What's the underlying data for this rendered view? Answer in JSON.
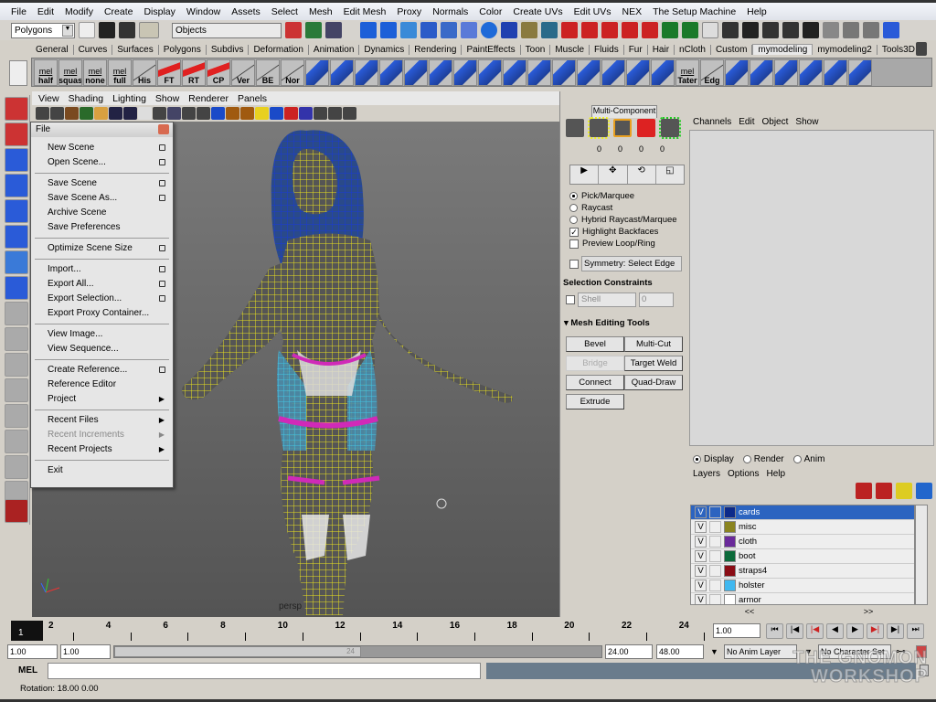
{
  "menubar": [
    "File",
    "Edit",
    "Modify",
    "Create",
    "Display",
    "Window",
    "Assets",
    "Select",
    "Mesh",
    "Edit Mesh",
    "Proxy",
    "Normals",
    "Color",
    "Create UVs",
    "Edit UVs",
    "NEX",
    "The Setup Machine",
    "Help"
  ],
  "status": {
    "mode": "Polygons",
    "selection_mask": "Objects"
  },
  "shelf_tabs": [
    "General",
    "Curves",
    "Surfaces",
    "Polygons",
    "Subdivs",
    "Deformation",
    "Animation",
    "Dynamics",
    "Rendering",
    "PaintEffects",
    "Toon",
    "Muscle",
    "Fluids",
    "Fur",
    "Hair",
    "nCloth",
    "Custom",
    "mymodeling",
    "mymodeling2",
    "Tools3D"
  ],
  "shelf_active": "mymodeling",
  "shelf_labels": [
    "half",
    "squas",
    "none",
    "full",
    "His",
    "FT",
    "RT",
    "CP",
    "Ver",
    "BE",
    "Nor",
    "",
    "",
    "",
    "",
    "",
    "",
    "",
    "",
    "",
    "",
    "",
    "",
    "",
    "",
    "",
    "Tater",
    "Edg",
    "",
    "",
    "",
    "",
    "",
    ""
  ],
  "viewport": {
    "menu": [
      "View",
      "Shading",
      "Lighting",
      "Show",
      "Renderer",
      "Panels"
    ],
    "camera": "persp"
  },
  "file_menu": {
    "title": "File",
    "groups": [
      [
        {
          "label": "New Scene",
          "opt": true
        },
        {
          "label": "Open Scene...",
          "opt": true
        }
      ],
      [
        {
          "label": "Save Scene",
          "opt": true
        },
        {
          "label": "Save Scene As...",
          "opt": true
        },
        {
          "label": "Archive Scene"
        },
        {
          "label": "Save Preferences"
        }
      ],
      [
        {
          "label": "Optimize Scene Size",
          "opt": true
        }
      ],
      [
        {
          "label": "Import...",
          "opt": true
        },
        {
          "label": "Export All...",
          "opt": true
        },
        {
          "label": "Export Selection...",
          "opt": true
        },
        {
          "label": "Export Proxy Container..."
        }
      ],
      [
        {
          "label": "View Image..."
        },
        {
          "label": "View Sequence..."
        }
      ],
      [
        {
          "label": "Create Reference...",
          "opt": true
        },
        {
          "label": "Reference Editor"
        },
        {
          "label": "Project",
          "sub": true
        }
      ],
      [
        {
          "label": "Recent Files",
          "sub": true
        },
        {
          "label": "Recent Increments",
          "sub": true,
          "disabled": true
        },
        {
          "label": "Recent Projects",
          "sub": true
        }
      ],
      [
        {
          "label": "Exit"
        }
      ]
    ]
  },
  "toolkit": {
    "tab": "Multi-Component",
    "counts": [
      "0",
      "0",
      "0",
      "0"
    ],
    "options": [
      {
        "type": "radio",
        "label": "Pick/Marquee",
        "on": true
      },
      {
        "type": "radio",
        "label": "Raycast"
      },
      {
        "type": "radio",
        "label": "Hybrid Raycast/Marquee"
      },
      {
        "type": "check",
        "label": "Highlight Backfaces",
        "on": true
      },
      {
        "type": "check",
        "label": "Preview Loop/Ring"
      }
    ],
    "symmetry": "Symmetry: Select Edge",
    "constraints_title": "Selection Constraints",
    "constraint_value": "Shell",
    "constraint_num": "0",
    "mesh_title": "Mesh Editing Tools",
    "buttons": [
      {
        "label": "Bevel"
      },
      {
        "label": "Multi-Cut"
      },
      {
        "label": "Bridge",
        "disabled": true
      },
      {
        "label": "Target Weld"
      },
      {
        "label": "Connect"
      },
      {
        "label": "Quad-Draw"
      },
      {
        "label": "Extrude"
      }
    ]
  },
  "channel": {
    "menu": [
      "Channels",
      "Edit",
      "Object",
      "Show"
    ]
  },
  "layers": {
    "modes": [
      {
        "label": "Display",
        "on": true
      },
      {
        "label": "Render"
      },
      {
        "label": "Anim"
      }
    ],
    "menu": [
      "Layers",
      "Options",
      "Help"
    ],
    "items": [
      {
        "name": "cards",
        "color": "#0c2a8a",
        "active": true
      },
      {
        "name": "misc",
        "color": "#8a8420"
      },
      {
        "name": "cloth",
        "color": "#6a2a9a"
      },
      {
        "name": "boot",
        "color": "#0c6a3a"
      },
      {
        "name": "straps4",
        "color": "#8a0c14"
      },
      {
        "name": "holster",
        "color": "#40b8f0"
      },
      {
        "name": "armor",
        "color": "#ffffff"
      }
    ],
    "vis": "V",
    "nav": [
      "<<",
      ">>"
    ]
  },
  "time": {
    "ticks": [
      "2",
      "4",
      "6",
      "8",
      "10",
      "12",
      "14",
      "16",
      "18",
      "20",
      "22",
      "24"
    ],
    "current": "1",
    "current_field": "1.00",
    "start": "1.00",
    "range_start": "1.00",
    "range_end_label": "24",
    "range_end": "24.00",
    "end": "48.00",
    "anim_layer": "No Anim Layer",
    "char_set": "No Character Set"
  },
  "mel": {
    "label": "MEL"
  },
  "help": {
    "text": "Rotation:  18.00   0.00"
  },
  "watermark": "THE GNOMON WORKSHOP"
}
